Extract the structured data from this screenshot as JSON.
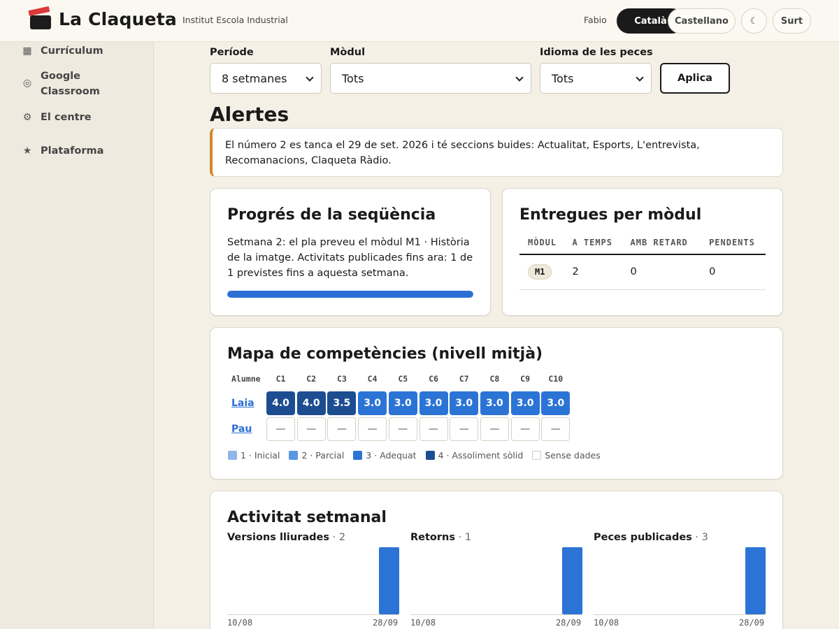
{
  "header": {
    "app_title": "La Claqueta",
    "subtitle": "Institut Escola Industrial",
    "user": "Fabio",
    "lang_ca": "Català",
    "lang_es": "Castellano",
    "theme_toggle": "☾",
    "logout": "Surt"
  },
  "sidebar": {
    "items": [
      {
        "label": "Currículum",
        "icon": "▦"
      },
      {
        "label": "Google Classroom",
        "icon": "◎"
      },
      {
        "label": "El centre",
        "icon": "⚙"
      },
      {
        "label": "Plataforma",
        "icon": "★"
      }
    ]
  },
  "filters": {
    "period_label": "Període",
    "period_value": "8 setmanes",
    "module_label": "Mòdul",
    "module_value": "Tots",
    "lang_label": "Idioma de les peces",
    "lang_value": "Tots",
    "apply": "Aplica"
  },
  "alerts": {
    "title": "Alertes",
    "message": "El número 2 es tanca el 29 de set. 2026 i té seccions buides: Actualitat, Esports, L'entrevista, Recomanacions, Claqueta Ràdio."
  },
  "sequence": {
    "title": "Progrés de la seqüència",
    "text": "Setmana 2: el pla preveu el mòdul M1 · Història de la imatge. Activitats publicades fins ara: 1 de 1 previstes fins a aquesta setmana.",
    "progress": 1.0
  },
  "deliveries": {
    "title": "Entregues per mòdul",
    "columns": [
      "MÒDUL",
      "A TEMPS",
      "AMB RETARD",
      "PENDENTS"
    ],
    "rows": [
      {
        "module": "M1",
        "on_time": "2",
        "late": "0",
        "pending": "0"
      }
    ]
  },
  "competences": {
    "title": "Mapa de competències (nivell mitjà)",
    "student_col": "Alumne",
    "columns": [
      "C1",
      "C2",
      "C3",
      "C4",
      "C5",
      "C6",
      "C7",
      "C8",
      "C9",
      "C10"
    ],
    "students": [
      {
        "name": "Laia",
        "values": [
          "4.0",
          "4.0",
          "3.5",
          "3.0",
          "3.0",
          "3.0",
          "3.0",
          "3.0",
          "3.0",
          "3.0"
        ],
        "levels": [
          4,
          4,
          4,
          3,
          3,
          3,
          3,
          3,
          3,
          3
        ]
      },
      {
        "name": "Pau",
        "values": [
          "—",
          "—",
          "—",
          "—",
          "—",
          "—",
          "—",
          "—",
          "—",
          "—"
        ],
        "levels": [
          0,
          0,
          0,
          0,
          0,
          0,
          0,
          0,
          0,
          0
        ]
      }
    ],
    "legend": [
      {
        "label": "1 · Inicial",
        "color": "#8fb6ea"
      },
      {
        "label": "2 · Parcial",
        "color": "#5a97e2"
      },
      {
        "label": "3 · Adequat",
        "color": "#2b74d6"
      },
      {
        "label": "4 · Assoliment sòlid",
        "color": "#1d4d91"
      },
      {
        "label": "Sense dades",
        "color": "#ffffff"
      }
    ]
  },
  "weekly": {
    "title": "Activitat setmanal",
    "charts": [
      {
        "name": "Versions lliurades",
        "count": "2",
        "start": "10/08",
        "end": "28/09",
        "values": [
          0,
          0,
          0,
          0,
          0,
          0,
          0,
          2
        ]
      },
      {
        "name": "Retorns",
        "count": "1",
        "start": "10/08",
        "end": "28/09",
        "values": [
          0,
          0,
          0,
          0,
          0,
          0,
          0,
          1
        ]
      },
      {
        "name": "Peces publicades",
        "count": "3",
        "start": "10/08",
        "end": "28/09",
        "values": [
          0,
          0,
          0,
          0,
          0,
          0,
          0,
          3
        ]
      }
    ],
    "bar_color": "#2b74d6"
  }
}
